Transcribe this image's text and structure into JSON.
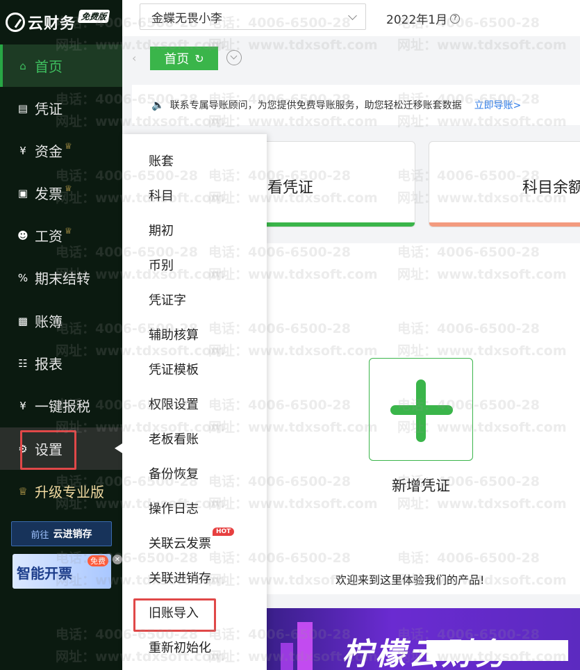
{
  "brand": {
    "name": "云财务",
    "badge": "免费版"
  },
  "sidebar": {
    "items": [
      {
        "label": "首页",
        "icon": "home-icon",
        "crown": false
      },
      {
        "label": "凭证",
        "icon": "voucher-icon",
        "crown": false
      },
      {
        "label": "资金",
        "icon": "fund-icon",
        "crown": true
      },
      {
        "label": "发票",
        "icon": "invoice-icon",
        "crown": true
      },
      {
        "label": "工资",
        "icon": "salary-icon",
        "crown": true
      },
      {
        "label": "期末结转",
        "icon": "percent-icon",
        "crown": false
      },
      {
        "label": "账簿",
        "icon": "ledger-chart-icon",
        "crown": false
      },
      {
        "label": "报表",
        "icon": "report-icon",
        "crown": false
      },
      {
        "label": "一键报税",
        "icon": "yen-circle-icon",
        "crown": false
      },
      {
        "label": "设置",
        "icon": "gear-icon",
        "crown": false
      },
      {
        "label": "升级专业版",
        "icon": "crown-icon",
        "crown": false
      }
    ],
    "promo_erp": {
      "prefix": "前往",
      "name": "云进销存"
    },
    "promo_invoice": {
      "text": "智能开票",
      "badge": "免费"
    }
  },
  "topbar": {
    "account": "金蝶无畏小李",
    "period": "2022年1月",
    "help": "?"
  },
  "tabs": {
    "home": "首页",
    "refresh": "C"
  },
  "notice": {
    "text": "联系专属导账顾问，为您提供免费导账服务，助您轻松迁移账套数据",
    "link": "立即导账>"
  },
  "cards": {
    "view_voucher": "看凭证",
    "subject_balance": "科目余额"
  },
  "main": {
    "add_voucher": "新增凭证",
    "welcome": "欢迎来到这里体验我们的产品!"
  },
  "banner": {
    "text": "柠檬云财务"
  },
  "settings_menu": {
    "items": [
      "账套",
      "科目",
      "期初",
      "币别",
      "凭证字",
      "辅助核算",
      "凭证模板",
      "权限设置",
      "老板看账",
      "备份恢复",
      "操作日志",
      "关联云发票",
      "关联进销存",
      "旧账导入",
      "重新初始化"
    ],
    "hot_badge": "HOT"
  },
  "watermark": {
    "phone": "电话：4006-6500-28",
    "site": "网址：www.tdxsoft.com"
  },
  "colors": {
    "accent": "#3ab54a",
    "sidebar_bg": "#0b1a10",
    "highlight_red": "#e04848",
    "link_blue": "#2d7ae6",
    "card_bar_orange": "#f39b7f"
  }
}
